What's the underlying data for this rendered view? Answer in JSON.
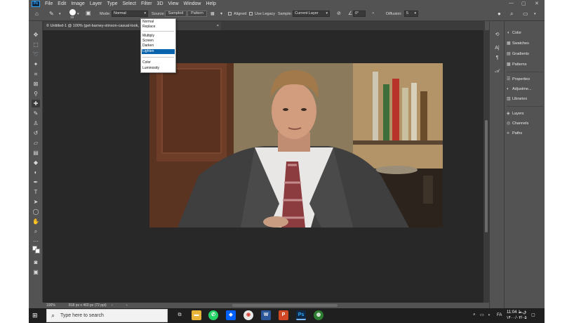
{
  "app": {
    "logo_text": "Ps",
    "menu": [
      "File",
      "Edit",
      "Image",
      "Layer",
      "Type",
      "Select",
      "Filter",
      "3D",
      "View",
      "Window",
      "Help"
    ],
    "window_controls": [
      "—",
      "▢",
      "✕"
    ]
  },
  "options_bar": {
    "brush_size": "19",
    "mode_label": "Mode:",
    "mode_value": "Normal",
    "source_label": "Source:",
    "sampled_label": "Sampled",
    "pattern_label": "Pattern",
    "aligned_label": "Aligned",
    "use_legacy_label": "Use Legacy",
    "sample_label": "Sample:",
    "sample_value": "Current Layer",
    "angle_value": "0°",
    "diffusion_label": "Diffusion:",
    "diffusion_value": "5"
  },
  "mode_dropdown": {
    "group1": [
      "Normal",
      "Replace"
    ],
    "group2": [
      "Multiply",
      "Screen",
      "Darken",
      "Lighten"
    ],
    "group3": [
      "Color",
      "Luminosity"
    ],
    "selected": "Lighten"
  },
  "document": {
    "tab_title": "© Untitled-1 @ 100% (get-barney-stinson-casual-look, RGB/8#) *",
    "tab_close": "×"
  },
  "status_bar": {
    "zoom": "100%",
    "doc_info": "818 px x 460 px (72 ppi)"
  },
  "panels": {
    "group1": [
      "Color",
      "Swatches",
      "Gradients",
      "Patterns"
    ],
    "group2": [
      "Properties",
      "Adjustme...",
      "Libraries"
    ],
    "group3": [
      "Layers",
      "Channels",
      "Paths"
    ]
  },
  "taskbar": {
    "search_placeholder": "Type here to search",
    "clock_time": "11:04 ق.ظ",
    "clock_date": "۱۴۰۰/۰۳/۰۵",
    "language": "FA"
  },
  "colors": {
    "ps_chrome": "#535353",
    "canvas_bg": "#282828",
    "accent": "#0a64ad"
  }
}
